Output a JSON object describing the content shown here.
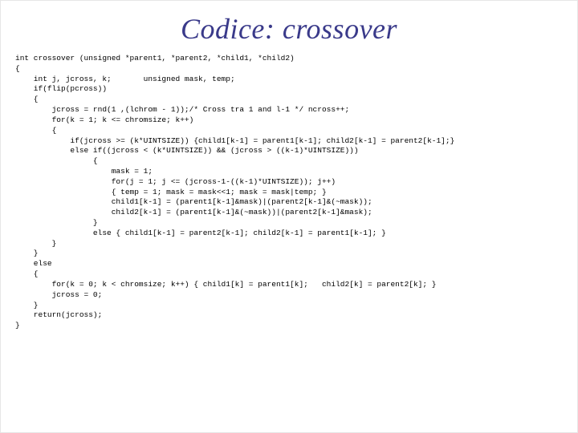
{
  "title": "Codice: crossover",
  "code": "int crossover (unsigned *parent1, *parent2, *child1, *child2)\n{\n    int j, jcross, k;       unsigned mask, temp;\n    if(flip(pcross))\n    {\n        jcross = rnd(1 ,(lchrom - 1));/* Cross tra 1 and l-1 */ ncross++;\n        for(k = 1; k <= chromsize; k++)\n        {\n            if(jcross >= (k*UINTSIZE)) {child1[k-1] = parent1[k-1]; child2[k-1] = parent2[k-1];}\n            else if((jcross < (k*UINTSIZE)) && (jcross > ((k-1)*UINTSIZE)))\n                 {\n                     mask = 1;\n                     for(j = 1; j <= (jcross-1-((k-1)*UINTSIZE)); j++)\n                     { temp = 1; mask = mask<<1; mask = mask|temp; }\n                     child1[k-1] = (parent1[k-1]&mask)|(parent2[k-1]&(~mask));\n                     child2[k-1] = (parent1[k-1]&(~mask))|(parent2[k-1]&mask);\n                 }\n                 else { child1[k-1] = parent2[k-1]; child2[k-1] = parent1[k-1]; }\n        }\n    }\n    else\n    {\n        for(k = 0; k < chromsize; k++) { child1[k] = parent1[k];   child2[k] = parent2[k]; }\n        jcross = 0;\n    }\n    return(jcross);\n}"
}
